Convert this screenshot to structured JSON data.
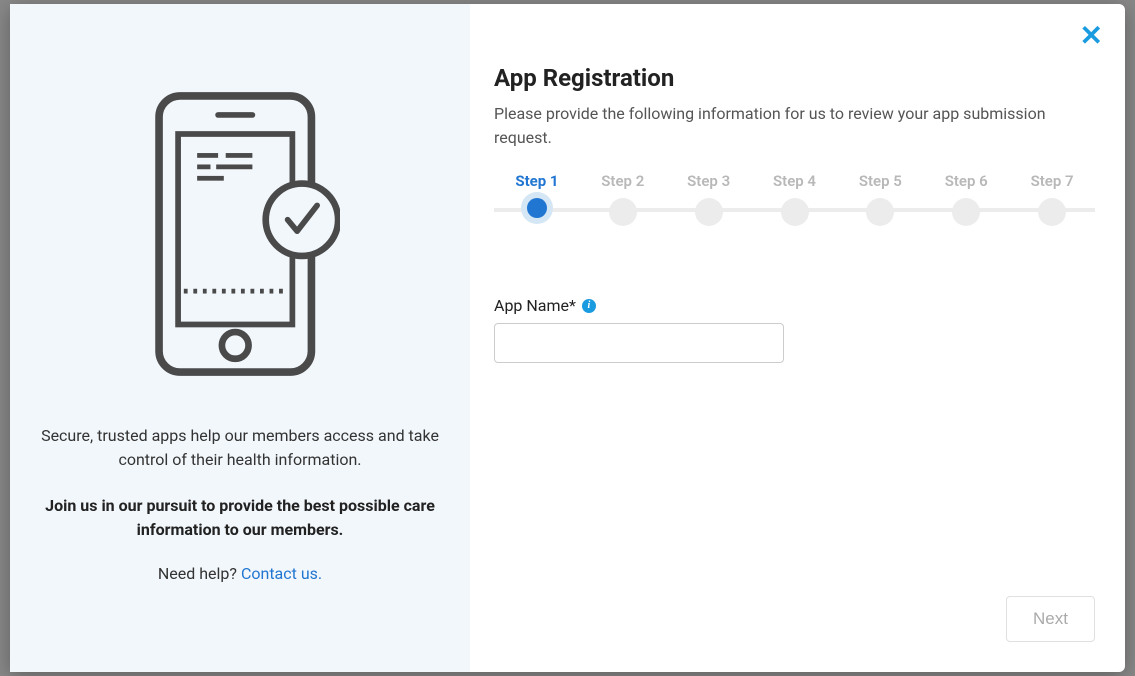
{
  "left": {
    "tagline": "Secure, trusted apps help our members access and take control of their health information.",
    "pursuit": "Join us in our pursuit to provide the best possible care information to our members.",
    "help_prefix": "Need help? ",
    "contact": "Contact us."
  },
  "modal": {
    "title": "App Registration",
    "description": "Please provide the following information for us to review your app submission request."
  },
  "stepper": {
    "steps": [
      "Step 1",
      "Step 2",
      "Step 3",
      "Step 4",
      "Step 5",
      "Step 6",
      "Step 7"
    ],
    "active": 0
  },
  "field": {
    "label": "App Name*",
    "value": ""
  },
  "buttons": {
    "next": "Next"
  }
}
